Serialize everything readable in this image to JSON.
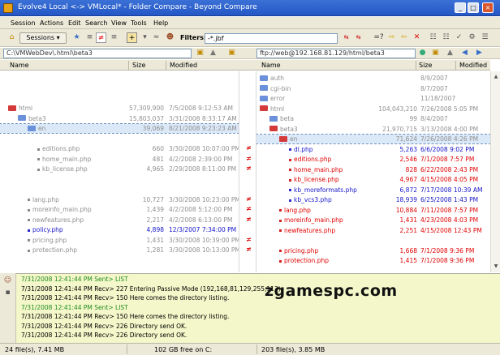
{
  "window": {
    "title": "Evolve4  Local <-> VMLocal* - Folder Compare - Beyond Compare"
  },
  "menu": [
    "Session",
    "Actions",
    "Edit",
    "Search",
    "View",
    "Tools",
    "Help"
  ],
  "toolbar": {
    "sessions_label": "Sessions",
    "filters_label": "Filters:",
    "filter_value": "-*.jbf"
  },
  "left_path": "C:\\VMWebDev\\.html\\beta3",
  "right_path": "ftp://web@192.168.81.129/html/beta3",
  "columns": {
    "name": "Name",
    "size": "Size",
    "modified": "Modified"
  },
  "left_rows": [
    {
      "name": "html",
      "size": "57,309,900",
      "date": "7/5/2008 9:12:53 AM",
      "kind": "folder-red",
      "style": "gray",
      "indent": 0
    },
    {
      "name": "beta3",
      "size": "15,803,037",
      "date": "3/31/2008 8:33:17 AM",
      "kind": "folder",
      "style": "gray",
      "indent": 1
    },
    {
      "name": "en",
      "size": "39,069",
      "date": "8/21/2008 9:23:23 AM",
      "kind": "folder",
      "style": "gray",
      "indent": 2
    },
    {
      "name": "",
      "size": "",
      "date": "",
      "kind": "empty",
      "style": "gray",
      "indent": 3
    },
    {
      "name": "editions.php",
      "size": "660",
      "date": "3/30/2008 10:07:00 PM",
      "kind": "file",
      "style": "gray",
      "indent": 3
    },
    {
      "name": "home_main.php",
      "size": "481",
      "date": "4/2/2008 2:39:00 PM",
      "kind": "file",
      "style": "gray",
      "indent": 3
    },
    {
      "name": "kb_license.php",
      "size": "4,965",
      "date": "2/29/2008 8:11:00 PM",
      "kind": "file",
      "style": "gray",
      "indent": 3
    },
    {
      "name": "",
      "size": "",
      "date": "",
      "kind": "empty",
      "style": "gray",
      "indent": 3
    },
    {
      "name": "",
      "size": "",
      "date": "",
      "kind": "empty",
      "style": "gray",
      "indent": 3
    },
    {
      "name": "lang.php",
      "size": "10,727",
      "date": "3/30/2008 10:23:00 PM",
      "kind": "file",
      "style": "gray",
      "indent": 2
    },
    {
      "name": "moreinfo_main.php",
      "size": "1,439",
      "date": "4/2/2008 5:12:00 PM",
      "kind": "file",
      "style": "gray",
      "indent": 2
    },
    {
      "name": "newfeatures.php",
      "size": "2,217",
      "date": "4/2/2008 6:13:00 PM",
      "kind": "file",
      "style": "gray",
      "indent": 2
    },
    {
      "name": "policy.php",
      "size": "4,898",
      "date": "12/3/2007 7:34:00 PM",
      "kind": "file-blue",
      "style": "blue",
      "indent": 2
    },
    {
      "name": "pricing.php",
      "size": "1,431",
      "date": "3/30/2008 10:39:00 PM",
      "kind": "file",
      "style": "gray",
      "indent": 2
    },
    {
      "name": "protection.php",
      "size": "1,281",
      "date": "3/30/2008 10:13:00 PM",
      "kind": "file",
      "style": "gray",
      "indent": 2
    }
  ],
  "right_rows": [
    {
      "name": "auth",
      "size": "",
      "date": "8/9/2007",
      "kind": "folder",
      "style": "gray",
      "indent": 0
    },
    {
      "name": "cgi-bin",
      "size": "",
      "date": "8/7/2007",
      "kind": "folder",
      "style": "gray",
      "indent": 0
    },
    {
      "name": "error",
      "size": "",
      "date": "11/18/2007",
      "kind": "folder",
      "style": "gray",
      "indent": 0
    },
    {
      "name": "html",
      "size": "104,043,210",
      "date": "7/26/2008 5:05 PM",
      "kind": "folder-red",
      "style": "gray",
      "indent": 0
    },
    {
      "name": "beta",
      "size": "99",
      "date": "8/4/2007",
      "kind": "folder",
      "style": "gray",
      "indent": 1
    },
    {
      "name": "beta3",
      "size": "21,970,715",
      "date": "3/13/2008 4:00 PM",
      "kind": "folder-red",
      "style": "gray",
      "indent": 1
    },
    {
      "name": "en",
      "size": "71,624",
      "date": "7/26/2008 4:26 PM",
      "kind": "folder-red",
      "style": "gray",
      "indent": 2
    },
    {
      "name": "dl.php",
      "size": "5,263",
      "date": "6/6/2008 9:02 PM",
      "kind": "file-blue",
      "style": "blue",
      "indent": 3
    },
    {
      "name": "editions.php",
      "size": "2,546",
      "date": "7/1/2008 7:57 PM",
      "kind": "file-red",
      "style": "red",
      "indent": 3
    },
    {
      "name": "home_main.php",
      "size": "828",
      "date": "6/22/2008 2:43 PM",
      "kind": "file-red",
      "style": "red",
      "indent": 3
    },
    {
      "name": "kb_license.php",
      "size": "4,967",
      "date": "4/15/2008 4:05 PM",
      "kind": "file-red",
      "style": "red",
      "indent": 3
    },
    {
      "name": "kb_moreformats.php",
      "size": "6,872",
      "date": "7/17/2008 10:39 AM",
      "kind": "file-blue",
      "style": "blue",
      "indent": 3
    },
    {
      "name": "kb_vcs3.php",
      "size": "18,939",
      "date": "6/25/2008 1:43 PM",
      "kind": "file-blue",
      "style": "blue",
      "indent": 3
    },
    {
      "name": "lang.php",
      "size": "10,884",
      "date": "7/11/2008 7:57 PM",
      "kind": "file-red",
      "style": "red",
      "indent": 2
    },
    {
      "name": "moreinfo_main.php",
      "size": "1,431",
      "date": "4/23/2008 4:03 PM",
      "kind": "file-red",
      "style": "red",
      "indent": 2
    },
    {
      "name": "newfeatures.php",
      "size": "2,251",
      "date": "4/15/2008 12:43 PM",
      "kind": "file-red",
      "style": "red",
      "indent": 2
    },
    {
      "name": "",
      "size": "",
      "date": "",
      "kind": "empty",
      "style": "gray",
      "indent": 2
    },
    {
      "name": "pricing.php",
      "size": "1,668",
      "date": "7/1/2008 9:36 PM",
      "kind": "file-red",
      "style": "red",
      "indent": 2
    },
    {
      "name": "protection.php",
      "size": "1,415",
      "date": "7/1/2008 9:36 PM",
      "kind": "file-red",
      "style": "red",
      "indent": 2
    }
  ],
  "diff_marker": "≠",
  "log": [
    {
      "text": "7/31/2008 12:41:44 PM  Sent> LIST",
      "type": "sent"
    },
    {
      "text": "7/31/2008 12:41:44 PM  Recv> 227 Entering Passive Mode (192,168,81,129,255,113)",
      "type": "recv"
    },
    {
      "text": "7/31/2008 12:41:44 PM  Recv> 150 Here comes the directory listing.",
      "type": "recv"
    },
    {
      "text": "7/31/2008 12:41:44 PM  Sent> LIST",
      "type": "sent"
    },
    {
      "text": "7/31/2008 12:41:44 PM  Recv> 150 Here comes the directory listing.",
      "type": "recv"
    },
    {
      "text": "7/31/2008 12:41:44 PM  Recv> 226 Directory send OK.",
      "type": "recv"
    },
    {
      "text": "7/31/2008 12:41:44 PM  Recv> 226 Directory send OK.",
      "type": "recv"
    }
  ],
  "watermark": "zgamespc.com",
  "status": {
    "left": "24 file(s), 7.41 MB",
    "middle": "102 GB free on C:",
    "right": "203 file(s), 3.85 MB"
  }
}
